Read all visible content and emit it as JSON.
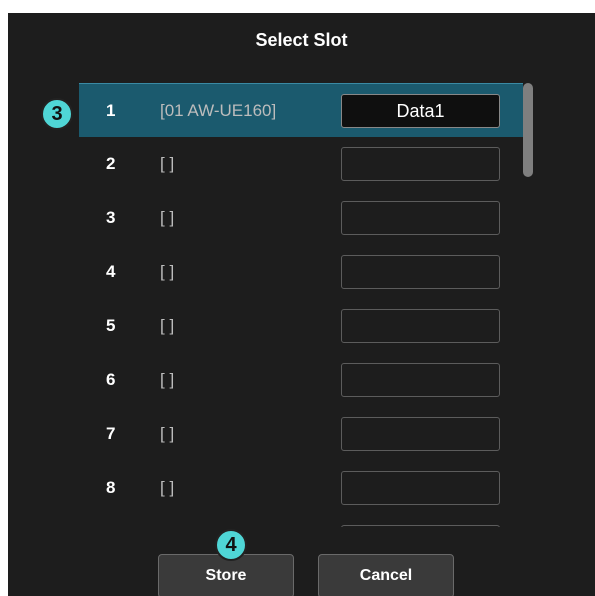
{
  "dialog": {
    "title": "Select Slot"
  },
  "slots": [
    {
      "number": "1",
      "camera": "[01 AW-UE160]",
      "name": "Data1",
      "selected": true
    },
    {
      "number": "2",
      "camera": "[ ]",
      "name": ""
    },
    {
      "number": "3",
      "camera": "[ ]",
      "name": ""
    },
    {
      "number": "4",
      "camera": "[ ]",
      "name": ""
    },
    {
      "number": "5",
      "camera": "[ ]",
      "name": ""
    },
    {
      "number": "6",
      "camera": "[ ]",
      "name": ""
    },
    {
      "number": "7",
      "camera": "[ ]",
      "name": ""
    },
    {
      "number": "8",
      "camera": "[ ]",
      "name": ""
    },
    {
      "number": "",
      "camera": "",
      "name": ""
    }
  ],
  "buttons": {
    "store_label": "Store",
    "cancel_label": "Cancel"
  },
  "callouts": {
    "list_marker": "3",
    "store_marker": "4"
  },
  "colors": {
    "dialog_bg": "#1d1d1d",
    "selected_row": "#1b5a6e",
    "callout": "#4fd6d6"
  }
}
